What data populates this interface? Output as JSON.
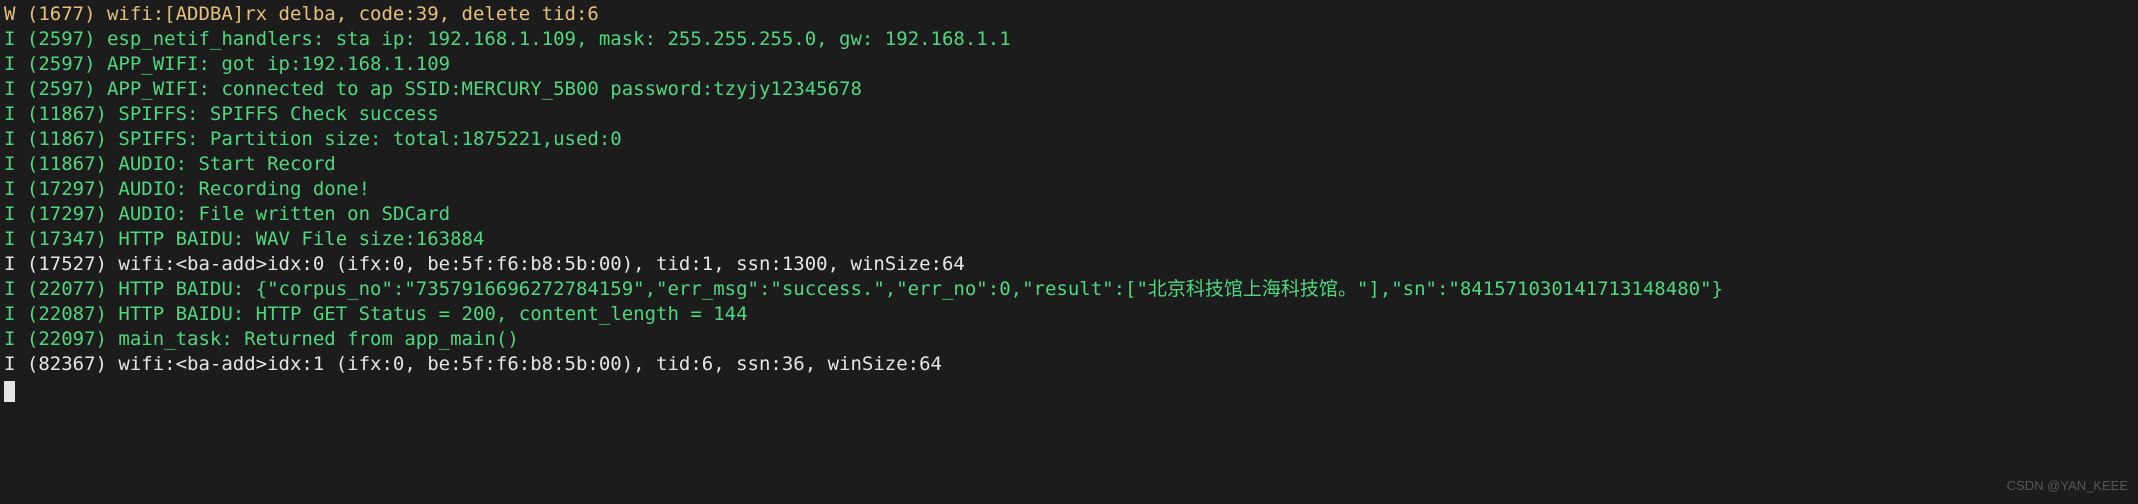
{
  "log": {
    "lines": [
      {
        "level": "W",
        "cls": "yellow",
        "text": "W (1677) wifi:[ADDBA]rx delba, code:39, delete tid:6"
      },
      {
        "level": "I",
        "cls": "green",
        "text": "I (2597) esp_netif_handlers: sta ip: 192.168.1.109, mask: 255.255.255.0, gw: 192.168.1.1"
      },
      {
        "level": "I",
        "cls": "green",
        "text": "I (2597) APP_WIFI: got ip:192.168.1.109"
      },
      {
        "level": "I",
        "cls": "green",
        "text": "I (2597) APP_WIFI: connected to ap SSID:MERCURY_5B00 password:tzyjy12345678"
      },
      {
        "level": "I",
        "cls": "green",
        "text": "I (11867) SPIFFS: SPIFFS Check success"
      },
      {
        "level": "I",
        "cls": "green",
        "text": "I (11867) SPIFFS: Partition size: total:1875221,used:0"
      },
      {
        "level": "I",
        "cls": "green",
        "text": "I (11867) AUDIO: Start Record"
      },
      {
        "level": "I",
        "cls": "green",
        "text": "I (17297) AUDIO: Recording done!"
      },
      {
        "level": "I",
        "cls": "green",
        "text": "I (17297) AUDIO: File written on SDCard"
      },
      {
        "level": "I",
        "cls": "green",
        "text": "I (17347) HTTP BAIDU: WAV File size:163884"
      },
      {
        "level": "I",
        "cls": "white",
        "text": "I (17527) wifi:<ba-add>idx:0 (ifx:0, be:5f:f6:b8:5b:00), tid:1, ssn:1300, winSize:64"
      },
      {
        "level": "I",
        "cls": "green",
        "text": "I (22077) HTTP BAIDU: {\"corpus_no\":\"7357916696272784159\",\"err_msg\":\"success.\",\"err_no\":0,\"result\":[\"北京科技馆上海科技馆。\"],\"sn\":\"841571030141713148480\"}"
      },
      {
        "level": "",
        "cls": "green",
        "text": ""
      },
      {
        "level": "I",
        "cls": "green",
        "text": "I (22087) HTTP BAIDU: HTTP GET Status = 200, content_length = 144"
      },
      {
        "level": "I",
        "cls": "green",
        "text": "I (22097) main_task: Returned from app_main()"
      },
      {
        "level": "I",
        "cls": "white",
        "text": "I (82367) wifi:<ba-add>idx:1 (ifx:0, be:5f:f6:b8:5b:00), tid:6, ssn:36, winSize:64"
      }
    ]
  },
  "watermark": "CSDN @YAN_KEEE"
}
